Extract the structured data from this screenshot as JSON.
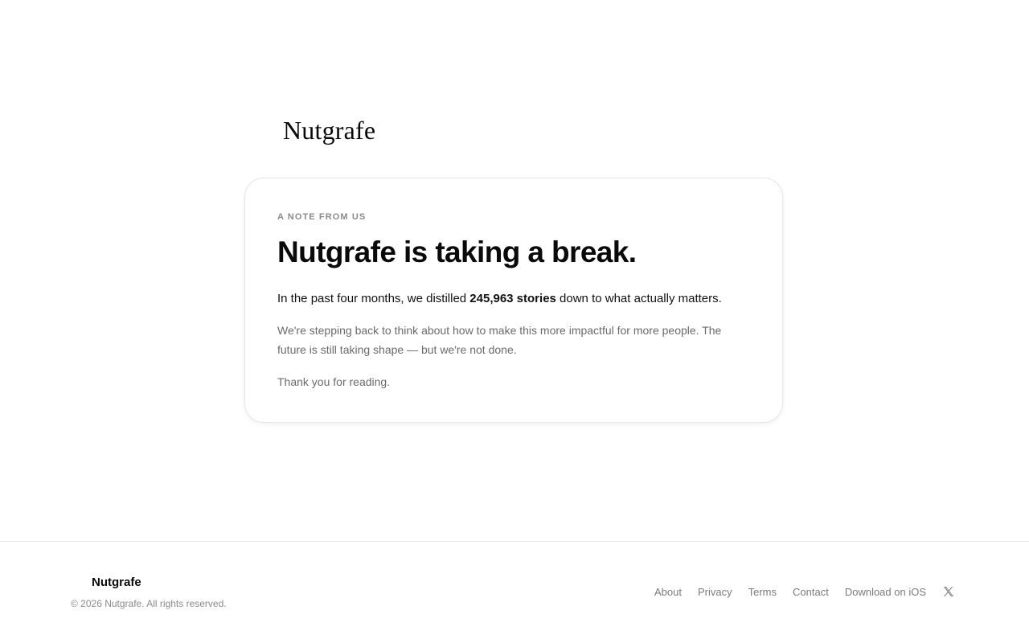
{
  "header": {
    "logo": "Nutgrafe"
  },
  "card": {
    "eyebrow": "A NOTE FROM US",
    "headline": "Nutgrafe is taking a break.",
    "lead_prefix": "In the past four months, we distilled ",
    "lead_bold": "245,963 stories",
    "lead_suffix": " down to what actually matters.",
    "body": "We're stepping back to think about how to make this more impactful for more people. The future is still taking shape — but we're not done.",
    "thanks": "Thank you for reading."
  },
  "footer": {
    "brand": "Nutgrafe",
    "copyright": "© 2026 Nutgrafe. All rights reserved.",
    "links": {
      "about": "About",
      "privacy": "Privacy",
      "terms": "Terms",
      "contact": "Contact",
      "ios": "Download on iOS"
    },
    "social_icon": "x-icon"
  },
  "colors": {
    "text": "#0a0a0a",
    "muted": "#6b6b6b",
    "border": "#e6e6e6"
  }
}
